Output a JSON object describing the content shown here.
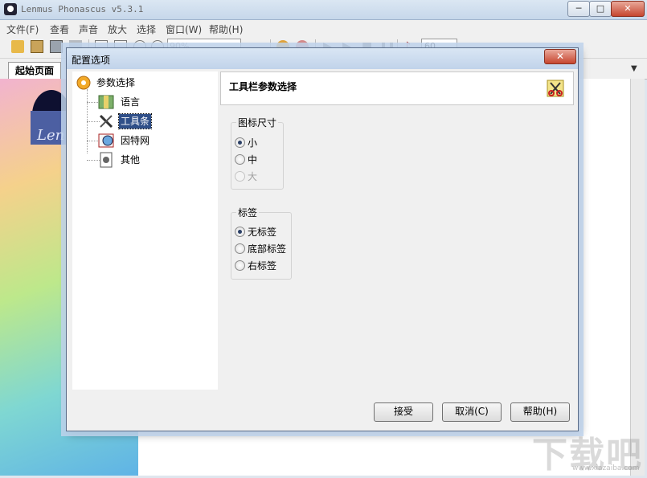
{
  "window": {
    "title": "Lenmus Phonascus v5.3.1",
    "controls": {
      "minimize": "─",
      "maximize": "□",
      "close": "✕"
    }
  },
  "menu": {
    "items": [
      "文件(F)",
      "查看",
      "声音",
      "放大",
      "选择",
      "窗口(W)",
      "帮助(H)"
    ]
  },
  "toolbar": {
    "zoom_value": "90%",
    "tempo_value": "60"
  },
  "tabs": {
    "active": "起始页面",
    "menu_arrow": "▼"
  },
  "document": {
    "logo_text": "Len"
  },
  "dialog": {
    "title": "配置选项",
    "close": "✕",
    "tree": {
      "root": "参数选择",
      "children": [
        "语言",
        "工具条",
        "因特网",
        "其他"
      ],
      "selected_index": 1
    },
    "pane_title": "工具栏参数选择",
    "icon_size_group": {
      "legend": "图标尺寸",
      "options": [
        "小",
        "中",
        "大"
      ],
      "selected": "小",
      "disabled": [
        "大"
      ]
    },
    "label_group": {
      "legend": "标签",
      "options": [
        "无标签",
        "底部标签",
        "右标签"
      ],
      "selected": "无标签"
    },
    "buttons": {
      "accept": "接受",
      "cancel": "取消(C)",
      "help": "帮助(H)"
    }
  },
  "watermark": {
    "main": "下载吧",
    "sub": "www.xiazaiba.com"
  }
}
